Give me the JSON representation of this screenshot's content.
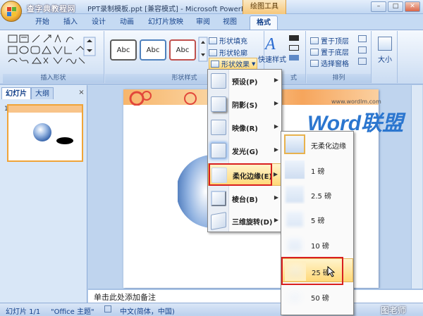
{
  "window": {
    "title": "PPT录制模板.ppt [兼容模式] - Microsoft PowerP...",
    "watermark": "查字典教程网",
    "context_tab_group": "绘图工具",
    "min": "–",
    "max": "□",
    "close": "✕"
  },
  "tabs": [
    "开始",
    "插入",
    "设计",
    "动画",
    "幻灯片放映",
    "审阅",
    "视图",
    "格式"
  ],
  "ribbon": {
    "insert_shapes_label": "插入形状",
    "shape_styles_label": "形状样式",
    "style_samples": [
      "Abc",
      "Abc",
      "Abc"
    ],
    "shape_fill": "形状填充",
    "shape_outline": "形状轮廓",
    "shape_effects": "形状效果",
    "quick_styles": "快速样式",
    "art_styles_label": "式",
    "bring_front": "置于顶层",
    "send_back": "置于底层",
    "selection_pane": "选择窗格",
    "arrange_label": "排列",
    "size": "大小"
  },
  "left_pane": {
    "tabs": [
      "幻灯片",
      "大纲"
    ],
    "close": "×",
    "slide_number": "1"
  },
  "menu": {
    "items": [
      {
        "label": "预设(P)"
      },
      {
        "label": "阴影(S)"
      },
      {
        "label": "映像(R)"
      },
      {
        "label": "发光(G)"
      },
      {
        "label": "柔化边缘(E)"
      },
      {
        "label": "棱台(B)"
      },
      {
        "label": "三维旋转(D)"
      }
    ]
  },
  "submenu": {
    "items": [
      {
        "label": "无柔化边缘"
      },
      {
        "label": "1 磅"
      },
      {
        "label": "2.5 磅"
      },
      {
        "label": "5 磅"
      },
      {
        "label": "10 磅"
      },
      {
        "label": "25 磅"
      },
      {
        "label": "50 磅"
      }
    ]
  },
  "slide": {
    "brand": "Word联盟",
    "url": "www.wordlm.com"
  },
  "notes": "单击此处添加备注",
  "status": {
    "slide_count": "幻灯片 1/1",
    "theme": "\"Office 主题\"",
    "language": "中文(简体，中国)"
  },
  "watermark_br": "图老师"
}
